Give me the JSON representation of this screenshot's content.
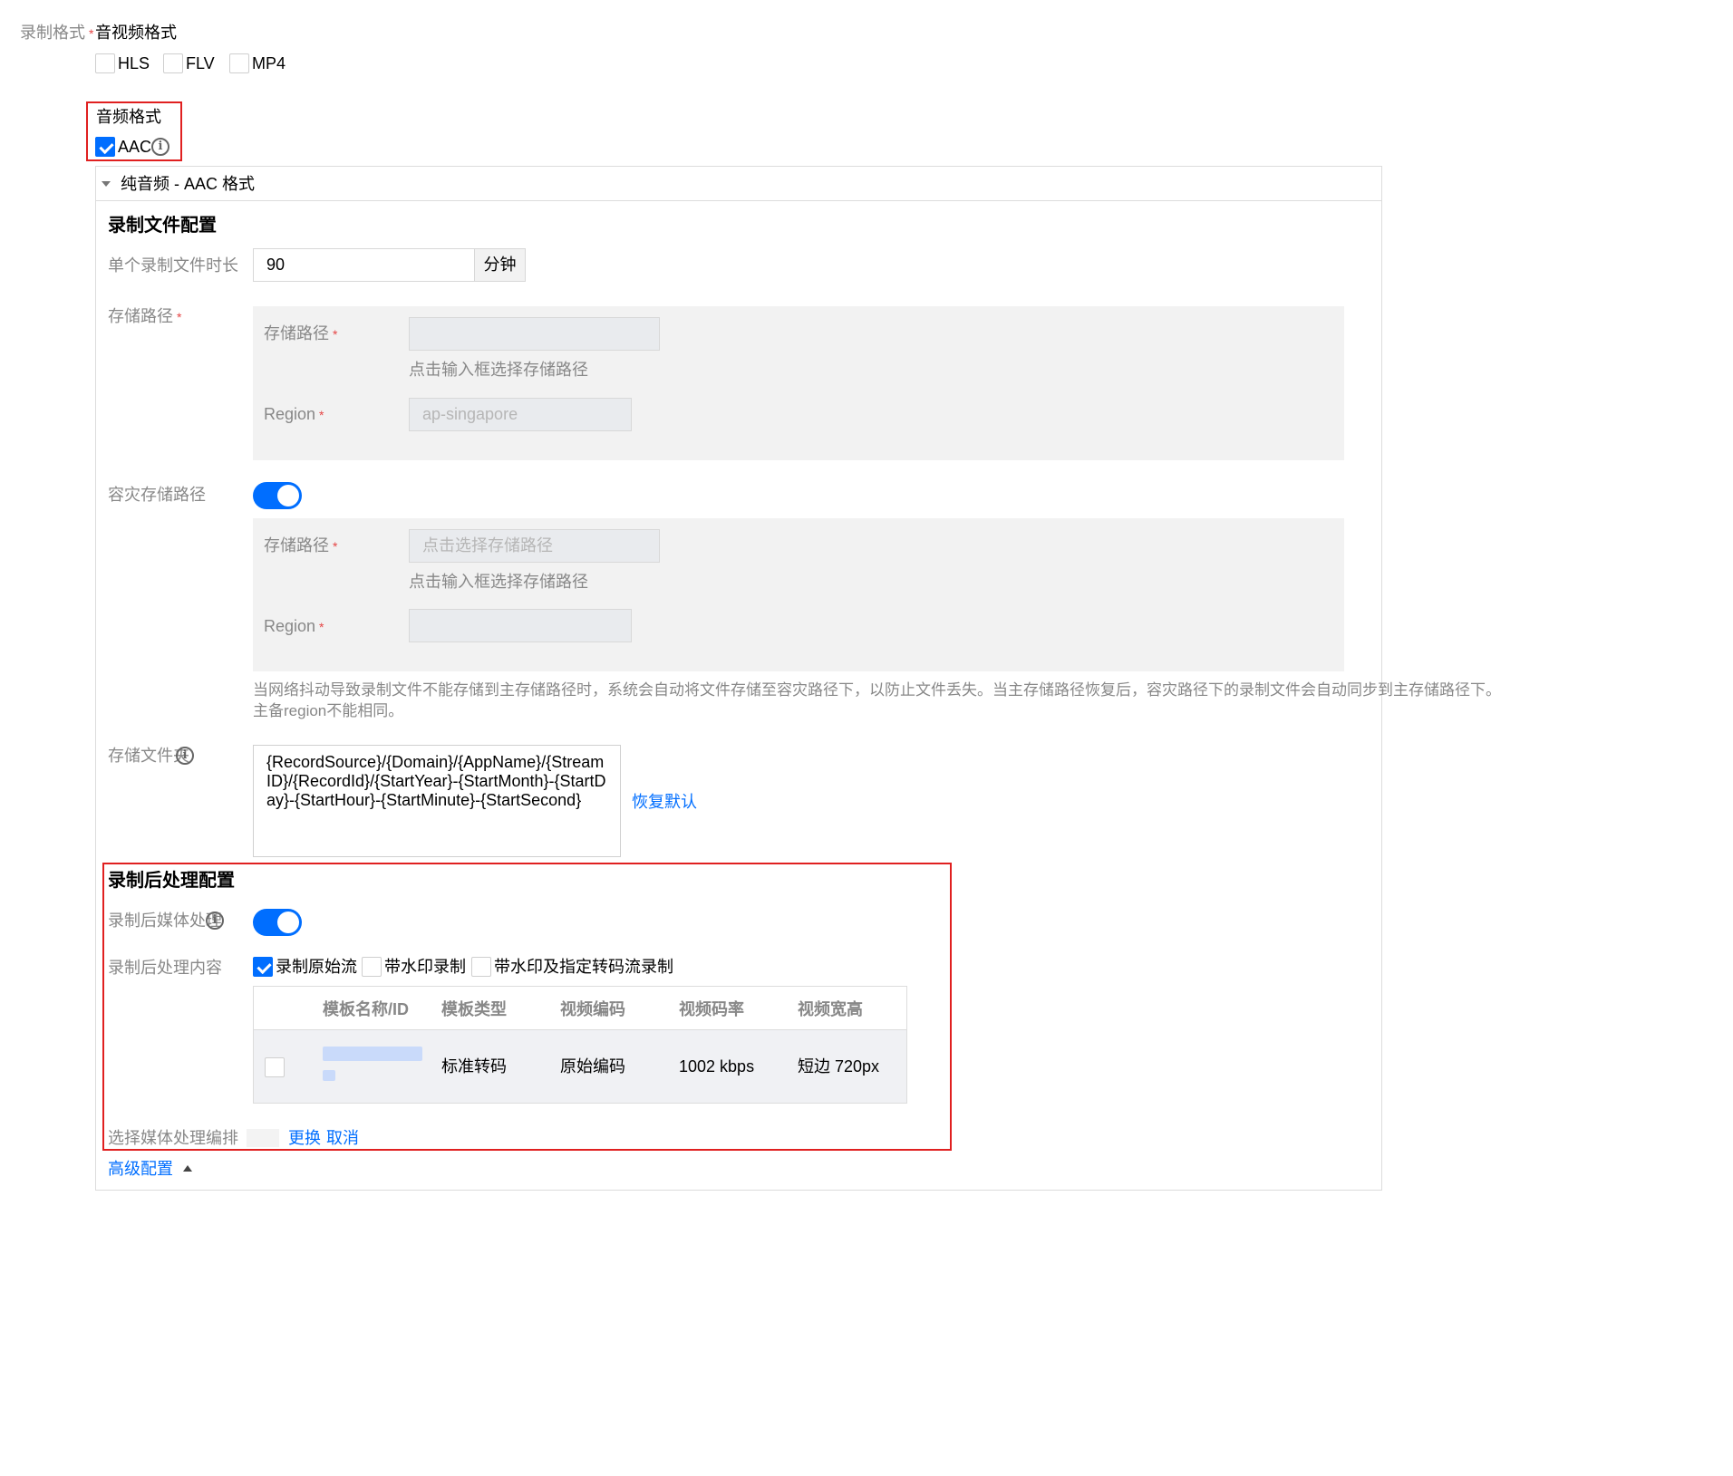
{
  "record_format": {
    "label": "录制格式",
    "required_mark": "*",
    "av_title": "音视频格式",
    "av_options": [
      {
        "label": "HLS",
        "checked": false
      },
      {
        "label": "FLV",
        "checked": false
      },
      {
        "label": "MP4",
        "checked": false
      }
    ],
    "audio_title": "音频格式",
    "audio_options": [
      {
        "label": "AAC",
        "checked": true
      }
    ]
  },
  "panel": {
    "collapse_title": "纯音频 - AAC 格式",
    "file_config_title": "录制文件配置",
    "duration": {
      "label": "单个录制文件时长",
      "value": "90",
      "unit": "分钟"
    },
    "storage": {
      "label": "存储路径",
      "path_label": "存储路径",
      "path_value": "",
      "path_hint": "点击输入框选择存储路径",
      "region_label": "Region",
      "region_value": "ap-singapore"
    },
    "backup": {
      "label": "容灾存储路径",
      "enabled": true,
      "path_label": "存储路径",
      "path_placeholder": "点击选择存储路径",
      "path_hint": "点击输入框选择存储路径",
      "region_label": "Region",
      "region_value": "",
      "description_line1": "当网络抖动导致录制文件不能存储到主存储路径时，系统会自动将文件存储至容灾路径下，以防止文件丢失。当主存储路径恢复后，容灾路径下的录制文件会自动同步到主存储路径下。",
      "description_line2": "主备region不能相同。"
    },
    "folder": {
      "label": "存储文件夹",
      "value": "{RecordSource}/{Domain}/{AppName}/{StreamID}/{RecordId}/{StartYear}-{StartMonth}-{StartDay}-{StartHour}-{StartMinute}-{StartSecond}",
      "restore_link": "恢复默认"
    },
    "post": {
      "title": "录制后处理配置",
      "media_label": "录制后媒体处理",
      "media_enabled": true,
      "content_label": "录制后处理内容",
      "content_options": [
        {
          "label": "录制原始流",
          "checked": true
        },
        {
          "label": "带水印录制",
          "checked": false
        },
        {
          "label": "带水印及指定转码流录制",
          "checked": false
        }
      ],
      "table": {
        "headers": [
          "模板名称/ID",
          "模板类型",
          "视频编码",
          "视频码率",
          "视频宽高"
        ],
        "rows": [
          {
            "checked": false,
            "name": "",
            "type": "标准转码",
            "codec": "原始编码",
            "bitrate": "1002 kbps",
            "size": "短边 720px"
          }
        ]
      },
      "orchestration_label": "选择媒体处理编排",
      "replace_link": "更换",
      "cancel_link": "取消"
    },
    "advanced_link": "高级配置"
  },
  "colors": {
    "accent": "#006eff",
    "highlight_border": "#e02020",
    "required": "#e54545"
  }
}
